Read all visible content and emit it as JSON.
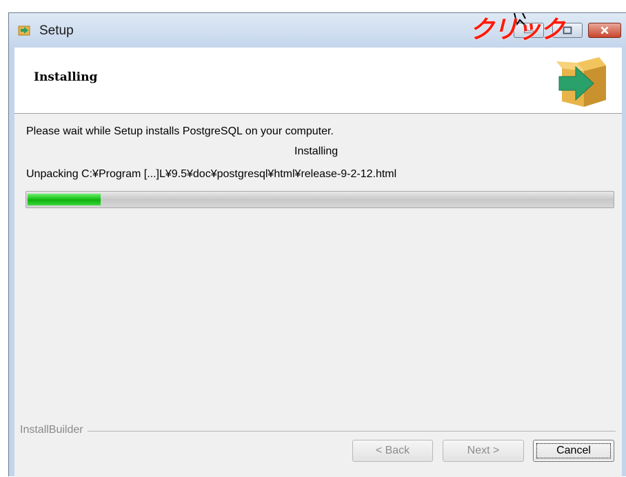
{
  "window": {
    "title": "Setup",
    "icon": "setup-arrow-icon"
  },
  "annotation": {
    "text": "クリック"
  },
  "header": {
    "title": "Installing",
    "logo": "installer-box-arrow-icon"
  },
  "body": {
    "message": "Please wait while Setup installs PostgreSQL on your computer.",
    "status": "Installing",
    "current_file": "Unpacking C:¥Program [...]L¥9.5¥doc¥postgresql¥html¥release-9-2-12.html",
    "progress_fraction": 0.125
  },
  "footer": {
    "brand": "InstallBuilder",
    "back_label": "< Back",
    "next_label": "Next >",
    "cancel_label": "Cancel"
  },
  "colors": {
    "progress": "#19c319",
    "annotation": "#ff1a0a",
    "logo_box": "#e8b44a",
    "logo_arrow": "#2aa06a"
  }
}
